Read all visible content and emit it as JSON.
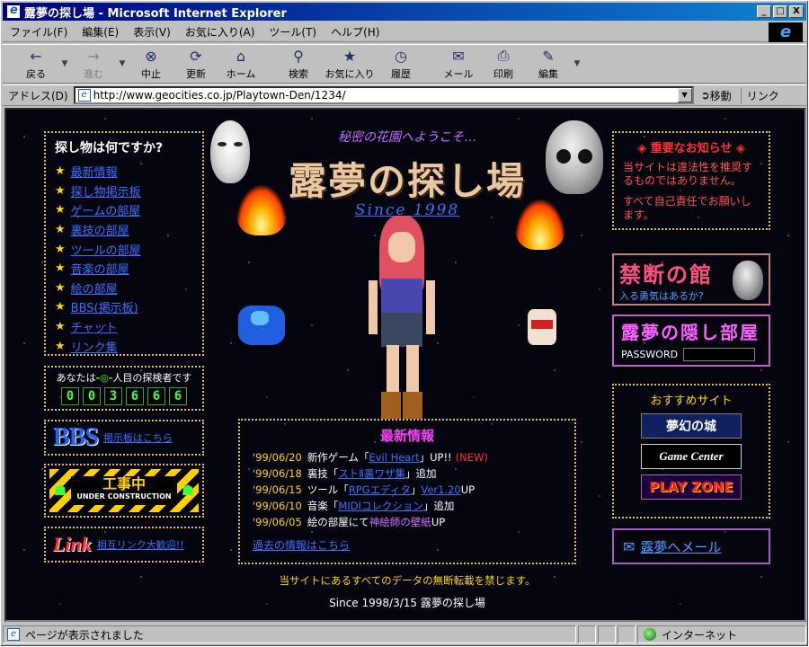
{
  "window": {
    "title": "露夢の探し場 - Microsoft Internet Explorer",
    "min": "_",
    "max": "□",
    "close": "X"
  },
  "menu": [
    "ファイル(F)",
    "編集(E)",
    "表示(V)",
    "お気に入り(A)",
    "ツール(T)",
    "ヘルプ(H)"
  ],
  "toolbar": [
    {
      "label": "戻る",
      "icon": "←",
      "enabled": true
    },
    {
      "label": "進む",
      "icon": "→",
      "enabled": false
    },
    {
      "label": "中止",
      "icon": "⊗",
      "enabled": true
    },
    {
      "label": "更新",
      "icon": "⟳",
      "enabled": true
    },
    {
      "label": "ホーム",
      "icon": "⌂",
      "enabled": true
    },
    {
      "label": "検索",
      "icon": "⚲",
      "enabled": true
    },
    {
      "label": "お気に入り",
      "icon": "★",
      "enabled": true
    },
    {
      "label": "履歴",
      "icon": "◷",
      "enabled": true
    },
    {
      "label": "メール",
      "icon": "✉",
      "enabled": true
    },
    {
      "label": "印刷",
      "icon": "⎙",
      "enabled": true
    },
    {
      "label": "編集",
      "icon": "✎",
      "enabled": true
    }
  ],
  "address": {
    "label": "アドレス(D)",
    "url": "http://www.geocities.co.jp/Playtown-Den/1234/",
    "go": "移動",
    "links": "リンク"
  },
  "page": {
    "subtitle": "秘密の花園へようこそ…",
    "title": "露夢の探し場",
    "since": "Since 1998",
    "nav": {
      "heading": "探し物は何ですか?",
      "items": [
        "最新情報",
        "探し物掲示板",
        "ゲームの部屋",
        "裏技の部屋",
        "ツールの部屋",
        "音楽の部屋",
        "絵の部屋",
        "BBS(掲示板)",
        "チャット",
        "リンク集"
      ]
    },
    "counter": {
      "prefix": "あなたは",
      "mark": "-◎-",
      "suffix": "人目の探検者です",
      "digits": [
        "0",
        "0",
        "3",
        "6",
        "6",
        "6"
      ]
    },
    "bbs": {
      "big": "BBS",
      "link": "掲示板はこちら"
    },
    "construction": {
      "main": "工事中",
      "sub": "UNDER CONSTRUCTION"
    },
    "linkbanner": {
      "big": "Link",
      "link": "相互リンク大歓迎!!"
    },
    "news": {
      "heading": "最新情報",
      "rows": [
        {
          "date": "'99/06/20",
          "pre": "新作ゲーム「",
          "link": "Evil Heart",
          "post": "」UP!!",
          "new": "(NEW)"
        },
        {
          "date": "'99/06/18",
          "pre": "裏技「",
          "link": "ストⅡ裏ワザ集",
          "post": "」追加",
          "new": ""
        },
        {
          "date": "'99/06/15",
          "pre": "ツール「",
          "link": "RPGエディタ",
          "post": "」",
          "link2": "Ver1.20",
          "post2": " UP",
          "new": ""
        },
        {
          "date": "'99/06/10",
          "pre": "音楽「",
          "link": "MIDIコレクション",
          "post": "」追加",
          "new": ""
        },
        {
          "date": "'99/06/05",
          "pre": "絵の部屋にて ",
          "purple": "神絵師の壁紙",
          "post": " UP",
          "new": ""
        }
      ],
      "past": "過去の情報はこちら"
    },
    "notice": {
      "heading": "重要なお知らせ",
      "p1": "当サイトは違法性を推奨するものではありません。",
      "p2": "すべて自己責任でお願いします。"
    },
    "kindan": {
      "big": "禁断の館",
      "sub": "入る勇気はあるか?"
    },
    "hidden": {
      "big": "露夢の隠し部屋",
      "pw": "PASSWORD"
    },
    "recs": {
      "heading": "おすすめサイト",
      "banners": [
        "夢幻の城",
        "Game Center",
        "PLAY ZONE"
      ]
    },
    "mail": "露夢へメール",
    "foot1": "当サイトにあるすべてのデータの無断転載を禁じます。",
    "foot2": "Since 1998/3/15  露夢の探し場"
  },
  "status": {
    "text": "ページが表示されました",
    "zone": "インターネット"
  }
}
